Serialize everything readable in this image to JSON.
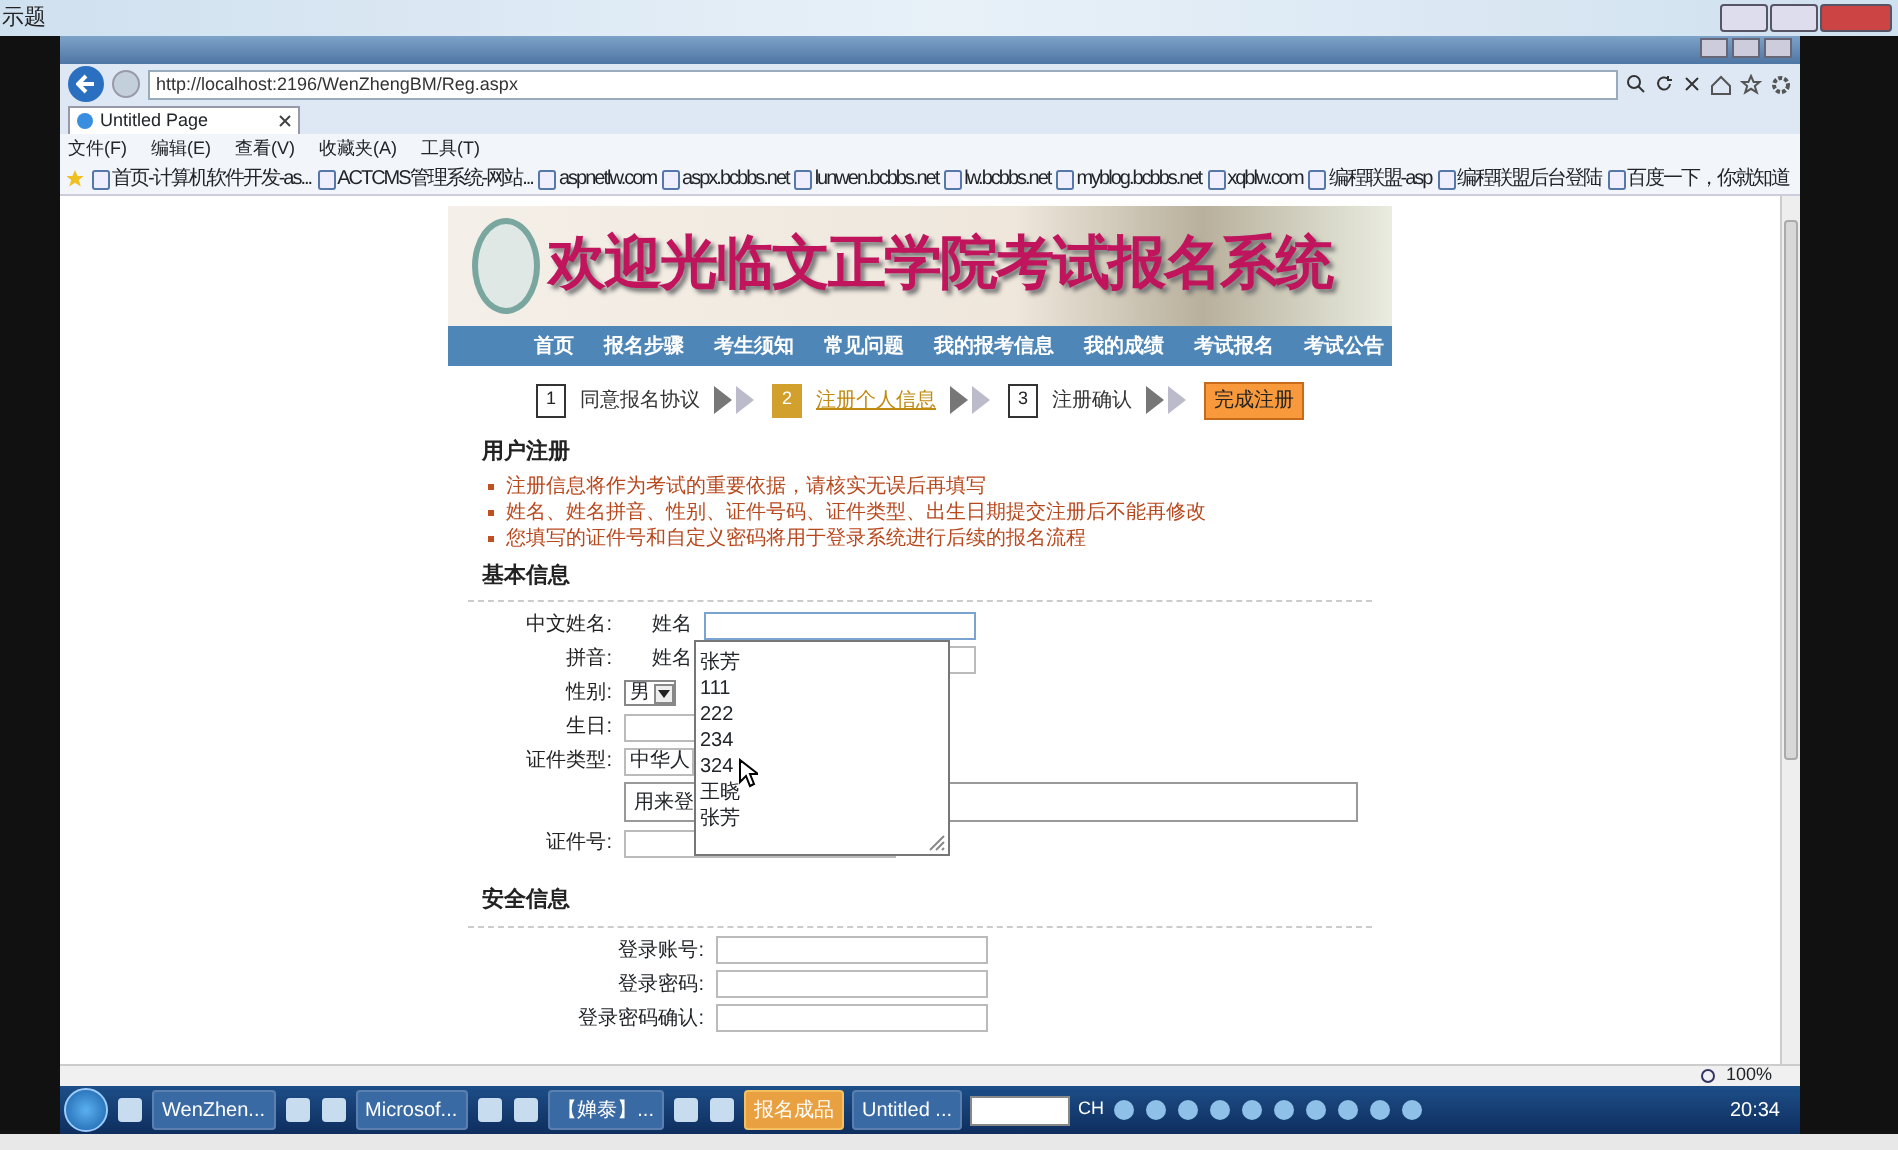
{
  "desktop": {
    "title_fragment": "示题"
  },
  "browser": {
    "address": "http://localhost:2196/WenZhengBM/Reg.aspx",
    "tab": "Untitled Page",
    "menu": [
      "文件(F)",
      "编辑(E)",
      "查看(V)",
      "收藏夹(A)",
      "工具(T)"
    ],
    "favorites": [
      "首页-计算机软件开发-as...",
      "ACTCMS管理系统-网站...",
      "aspnetlw.com",
      "aspx.bcbbs.net",
      "lunwen.bcbbs.net",
      "lw.bcbbs.net",
      "myblog.bcbbs.net",
      "xqblw.com",
      "编程联盟-asp",
      "编程联盟后台登陆",
      "百度一下，你就知道"
    ],
    "zoom": "100%"
  },
  "page": {
    "banner_title": "欢迎光临文正学院考试报名系统",
    "nav": [
      "首页",
      "报名步骤",
      "考生须知",
      "常见问题",
      "我的报考信息",
      "我的成绩",
      "考试报名",
      "考试公告"
    ],
    "steps": [
      {
        "number": "1",
        "label": "同意报名协议",
        "selected": false
      },
      {
        "number": "2",
        "label": "注册个人信息",
        "selected": true
      },
      {
        "number": "3",
        "label": "注册确认",
        "selected": false
      }
    ],
    "finish_button": "完成注册",
    "section_title": "用户注册",
    "notes": [
      "注册信息将作为考试的重要依据，请核实无误后再填写",
      "姓名、姓名拼音、性别、证件号码、证件类型、出生日期提交注册后不能再修改",
      "您填写的证件号和自定义密码将用于登录系统进行后续的报名流程"
    ],
    "basic_title": "基本信息",
    "basic_fields": [
      {
        "kind": "name",
        "label": "中文姓名:",
        "sub_label": "姓名"
      },
      {
        "kind": "name",
        "label": "拼音:",
        "sub_label": "姓名"
      },
      {
        "kind": "select",
        "label": "性别:",
        "value": "男"
      },
      {
        "kind": "text",
        "label": "生日:"
      },
      {
        "kind": "wide",
        "label": "证件类型:",
        "value": "中华人"
      },
      {
        "kind": "note",
        "value": "用来登"
      },
      {
        "kind": "text",
        "label": "证件号:"
      }
    ],
    "autocomplete": [
      "张芳",
      "111",
      "222",
      "234",
      "324",
      "王晓",
      "张芳"
    ],
    "security_title": "安全信息",
    "security_fields": [
      "登录账号:",
      "登录密码:",
      "登录密码确认:"
    ]
  },
  "taskbar": {
    "items": [
      {
        "label": "WenZhen...",
        "active": false
      },
      {
        "label": "Microsof...",
        "active": false
      },
      {
        "label": "【婵泰】...",
        "active": false
      },
      {
        "label": "报名成品",
        "active": true
      },
      {
        "label": "Untitled ...",
        "active": false
      }
    ],
    "language": "CH",
    "time": "20:34"
  }
}
